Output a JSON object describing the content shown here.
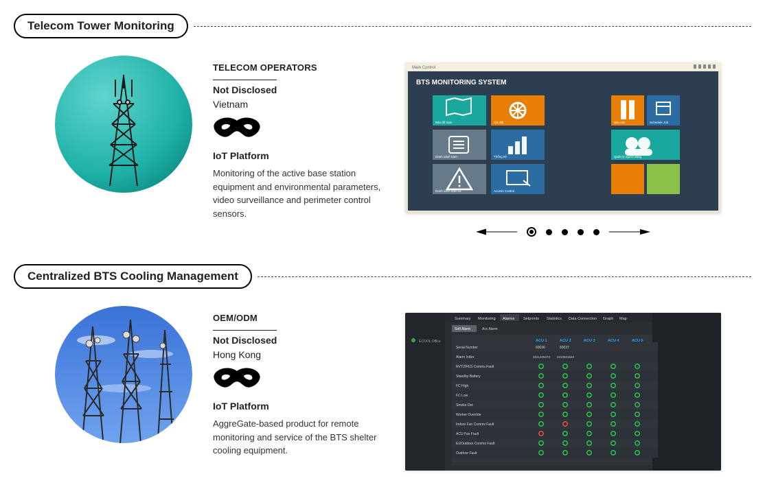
{
  "sections": [
    {
      "title": "Telecom Tower Monitoring",
      "category": "TELECOM OPERATORS",
      "client_name": "Not Disclosed",
      "client_country": "Vietnam",
      "platform_title": "IoT Platform",
      "description": "Monitoring of the active base station equipment and environmental parameters, video surveillance and perimeter control sensors."
    },
    {
      "title": "Centralized BTS Cooling Management",
      "category": "OEM/ODM",
      "client_name": "Not Disclosed",
      "client_country": "Hong Kong",
      "platform_title": "IoT Platform",
      "description": "AggreGate-based product for remote monitoring and service of the BTS shelter cooling equipment."
    }
  ],
  "screenshot1": {
    "window_title": "BTS MONITORING SYSTEM",
    "tile_colors": [
      "#1aa89e",
      "#e87e04",
      "#2d6ca2",
      "#e87e04",
      "#677a8a",
      "#2d6ca2",
      "#677a8a",
      "#2d6ca2",
      "#1aa89e",
      "#e87e04",
      "#8bc34a"
    ]
  },
  "screenshot2": {
    "tabs": [
      "Summary",
      "Monitoring",
      "Alarms",
      "Setpoints",
      "Statistics",
      "Data Connection",
      "Graph",
      "Map"
    ],
    "cols": [
      "ACU 1",
      "ACU 2",
      "ACU 3",
      "ACU 4",
      "ACU 5"
    ],
    "rows": [
      "Serial Number",
      "Alarm Index",
      "RVY2/FES Comms Fault",
      "Standby Battery",
      "FC High",
      "FC Low",
      "Smoke Det",
      "Worker Override",
      "Indoor Fan Comms Fault",
      "ACU Fan Fault",
      "Ex/Outdoor Comms Fault",
      "Outdoor Fault"
    ]
  },
  "carousel": {
    "total_dots": 5,
    "active": 0
  }
}
